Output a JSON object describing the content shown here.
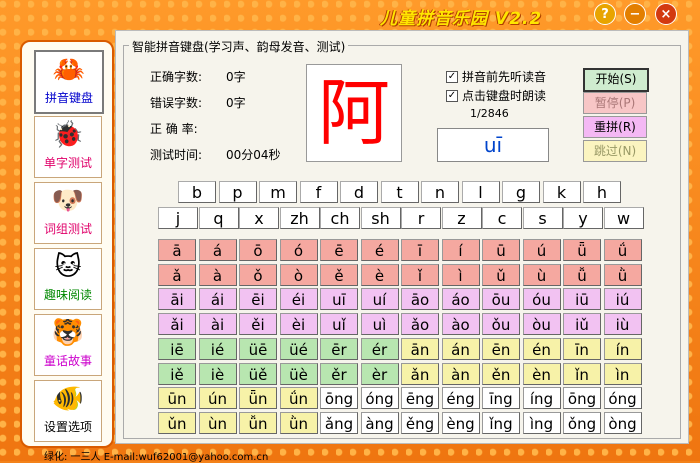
{
  "app": {
    "title": "儿童拼音乐园 V2.2",
    "help_label": "?",
    "minimize_label": "−",
    "close_label": "×"
  },
  "sidebar": {
    "items": [
      {
        "label": "拼音键盘",
        "icon": "🦀",
        "icon_name": "crab-icon"
      },
      {
        "label": "单字测试",
        "icon": "🐞",
        "icon_name": "ladybug-icon"
      },
      {
        "label": "词组测试",
        "icon": "🐶",
        "icon_name": "dog-icon"
      },
      {
        "label": "趣味阅读",
        "icon": "🐱",
        "icon_name": "cat-icon"
      },
      {
        "label": "童话故事",
        "icon": "🐯",
        "icon_name": "tiger-icon"
      },
      {
        "label": "设置选项",
        "icon": "🐠",
        "icon_name": "fish-icon"
      }
    ]
  },
  "panel": {
    "group_title": "智能拼音键盘(学习声、韵母发音、测试)",
    "stats": [
      {
        "label": "正确字数:",
        "value": "0字"
      },
      {
        "label": "错误字数:",
        "value": "0字"
      },
      {
        "label": "正 确 率:",
        "value": ""
      },
      {
        "label": "测试时间:",
        "value": "00分04秒"
      }
    ],
    "character": "阿",
    "pinyin": "uī",
    "checkbox1": {
      "label": "拼音前先听读音",
      "checked": "✓"
    },
    "checkbox2": {
      "label": "点击键盘时朗读",
      "checked": "✓"
    },
    "counter": "1/2846",
    "controls": {
      "start": "开始(S)",
      "pause": "暂停(P)",
      "reset": "重拼(R)",
      "skip": "跳过(N)"
    }
  },
  "keyboard": {
    "row1": [
      "b",
      "p",
      "m",
      "f",
      "d",
      "t",
      "n",
      "l",
      "g",
      "k",
      "h"
    ],
    "row2": [
      "j",
      "q",
      "x",
      "zh",
      "ch",
      "sh",
      "r",
      "z",
      "c",
      "s",
      "y",
      "w"
    ],
    "vowel_rows": [
      {
        "colors": [
          "salmon"
        ],
        "keys": [
          "ā",
          "á",
          "ō",
          "ó",
          "ē",
          "é",
          "ī",
          "í",
          "ū",
          "ú",
          "ǖ",
          "ǘ"
        ]
      },
      {
        "colors": [
          "salmon"
        ],
        "keys": [
          "ǎ",
          "à",
          "ǒ",
          "ò",
          "ě",
          "è",
          "ǐ",
          "ì",
          "ǔ",
          "ù",
          "ǚ",
          "ǜ"
        ]
      },
      {
        "colors": [
          "pink"
        ],
        "keys": [
          "āi",
          "ái",
          "ēi",
          "éi",
          "uī",
          "uí",
          "āo",
          "áo",
          "ōu",
          "óu",
          "iū",
          "iú"
        ]
      },
      {
        "colors": [
          "pink"
        ],
        "keys": [
          "ǎi",
          "ài",
          "ěi",
          "èi",
          "uǐ",
          "uì",
          "ǎo",
          "ào",
          "ǒu",
          "òu",
          "iǔ",
          "iù"
        ]
      },
      {
        "colors": [
          "green",
          "green",
          "green",
          "green",
          "green",
          "green",
          "yellow",
          "yellow",
          "yellow",
          "yellow",
          "yellow",
          "yellow"
        ],
        "keys": [
          "iē",
          "ié",
          "üē",
          "üé",
          "ēr",
          "ér",
          "ān",
          "án",
          "ēn",
          "én",
          "īn",
          "ín"
        ]
      },
      {
        "colors": [
          "green",
          "green",
          "green",
          "green",
          "green",
          "green",
          "yellow",
          "yellow",
          "yellow",
          "yellow",
          "yellow",
          "yellow"
        ],
        "keys": [
          "iě",
          "iè",
          "üě",
          "üè",
          "ěr",
          "èr",
          "ǎn",
          "àn",
          "ěn",
          "èn",
          "ǐn",
          "ìn"
        ]
      },
      {
        "colors": [
          "yellow",
          "yellow",
          "yellow",
          "yellow",
          "white",
          "white",
          "white",
          "white",
          "white",
          "white",
          "white",
          "white"
        ],
        "keys": [
          "ūn",
          "ún",
          "ǖn",
          "ǘn",
          "ōng",
          "óng",
          "ēng",
          "éng",
          "īng",
          "íng",
          "ōng",
          "óng"
        ]
      },
      {
        "colors": [
          "yellow",
          "yellow",
          "yellow",
          "yellow",
          "white",
          "white",
          "white",
          "white",
          "white",
          "white",
          "white",
          "white"
        ],
        "keys": [
          "ǔn",
          "ùn",
          "ǚn",
          "ǜn",
          "ǎng",
          "àng",
          "ěng",
          "èng",
          "ǐng",
          "ìng",
          "ǒng",
          "òng"
        ]
      }
    ]
  },
  "footer": {
    "text": "绿化: 一三人 E-mail:wuf62001@yahoo.com.cn"
  }
}
